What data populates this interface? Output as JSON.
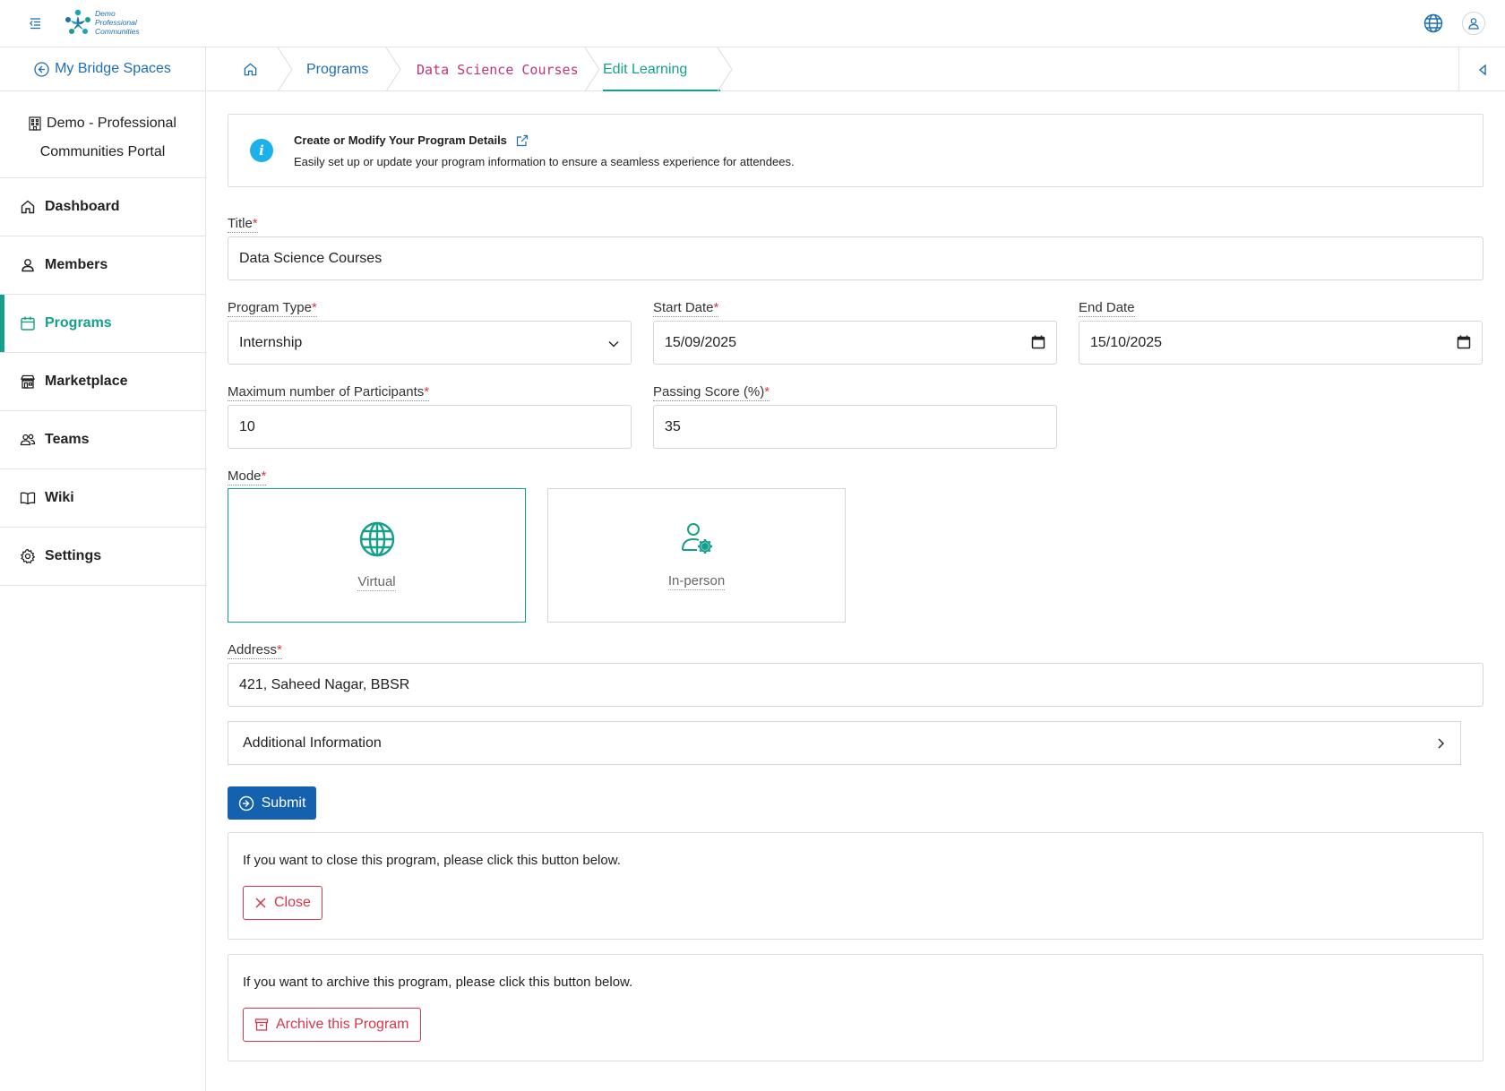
{
  "header": {
    "logo_lines": [
      "Demo",
      "Professional",
      "Communities"
    ]
  },
  "sidebar": {
    "back_link": "My Bridge Spaces",
    "portal_line1": "Demo - Professional",
    "portal_line2": "Communities Portal",
    "items": [
      {
        "label": "Dashboard",
        "icon": "home-icon"
      },
      {
        "label": "Members",
        "icon": "user-icon"
      },
      {
        "label": "Programs",
        "icon": "calendar-icon",
        "active": true
      },
      {
        "label": "Marketplace",
        "icon": "store-icon"
      },
      {
        "label": "Teams",
        "icon": "users-icon"
      },
      {
        "label": "Wiki",
        "icon": "book-icon"
      },
      {
        "label": "Settings",
        "icon": "gear-icon"
      }
    ]
  },
  "breadcrumb": {
    "programs": "Programs",
    "data_science": "Data Science Courses",
    "edit": "Edit Learning"
  },
  "info": {
    "title": "Create or Modify Your Program Details",
    "description": "Easily set up or update your program information to ensure a seamless experience for attendees."
  },
  "form": {
    "title_label": "Title",
    "title_value": "Data Science Courses",
    "program_type_label": "Program Type",
    "program_type_value": "Internship",
    "start_date_label": "Start Date",
    "start_date_value": "15/09/2025",
    "end_date_label": "End Date",
    "end_date_value": "15/10/2025",
    "max_participants_label": "Maximum number of Participants",
    "max_participants_value": "10",
    "passing_score_label": "Passing Score (%)",
    "passing_score_value": "35",
    "mode_label": "Mode",
    "mode_virtual": "Virtual",
    "mode_inperson": "In-person",
    "mode_selected": "Virtual",
    "address_label": "Address",
    "address_value": "421, Saheed Nagar, BBSR",
    "additional_info": "Additional Information",
    "submit": "Submit",
    "required_mark": "*"
  },
  "close_section": {
    "text": "If you want to close this program, please click this button below.",
    "button": "Close"
  },
  "archive_section": {
    "text": "If you want to archive this program, please click this button below.",
    "button": "Archive this Program"
  },
  "colors": {
    "accent": "#14a08a",
    "primary": "#1461b0",
    "danger": "#d9364d",
    "link": "#1d6fb0"
  }
}
